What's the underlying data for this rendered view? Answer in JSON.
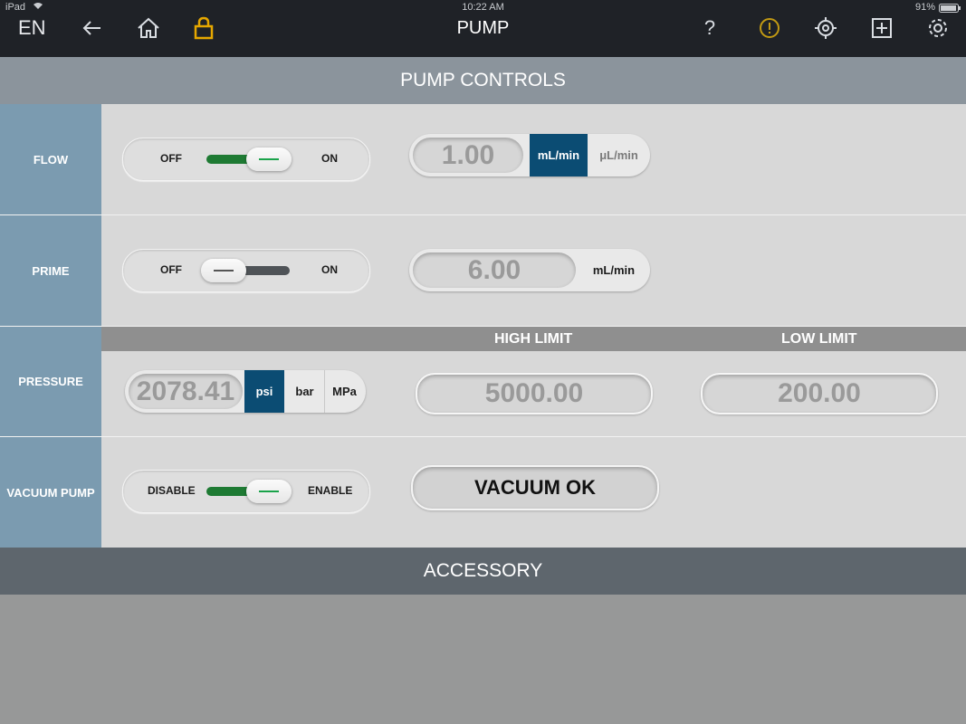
{
  "status_bar": {
    "device": "iPad",
    "time": "10:22 AM",
    "battery": "91%"
  },
  "header": {
    "language": "EN",
    "title": "PUMP",
    "icons": [
      "back-arrow-icon",
      "home-icon",
      "lock-icon",
      "help-icon",
      "alert-icon",
      "target-icon",
      "add-icon",
      "gear-icon"
    ],
    "lock_color": "#e6a700",
    "alert_color": "#c29a13"
  },
  "pump_controls": {
    "title": "PUMP CONTROLS",
    "flow": {
      "label": "FLOW",
      "toggle": {
        "off": "OFF",
        "on": "ON",
        "state": "on"
      },
      "value": "1.00",
      "units": [
        {
          "label": "mL/min",
          "active": true
        },
        {
          "label": "μL/min",
          "active": false
        }
      ]
    },
    "prime": {
      "label": "PRIME",
      "toggle": {
        "off": "OFF",
        "on": "ON",
        "state": "off"
      },
      "value": "6.00",
      "unit": "mL/min"
    },
    "pressure": {
      "label": "PRESSURE",
      "value": "2078.41",
      "units": [
        {
          "label": "psi",
          "active": true
        },
        {
          "label": "bar",
          "active": false
        },
        {
          "label": "MPa",
          "active": false
        }
      ],
      "high_limit_label": "HIGH LIMIT",
      "high_limit": "5000.00",
      "low_limit_label": "LOW LIMIT",
      "low_limit": "200.00"
    },
    "vacuum_pump": {
      "label": "VACUUM PUMP",
      "toggle": {
        "off": "DISABLE",
        "on": "ENABLE",
        "state": "on"
      },
      "status": "VACUUM OK"
    }
  },
  "accessory": {
    "title": "ACCESSORY"
  },
  "colors": {
    "accent_blue": "#0b4c73",
    "toggle_on": "#1e7a33",
    "toggle_off": "#4f5357",
    "row_label_bg": "#7b9bb0"
  }
}
